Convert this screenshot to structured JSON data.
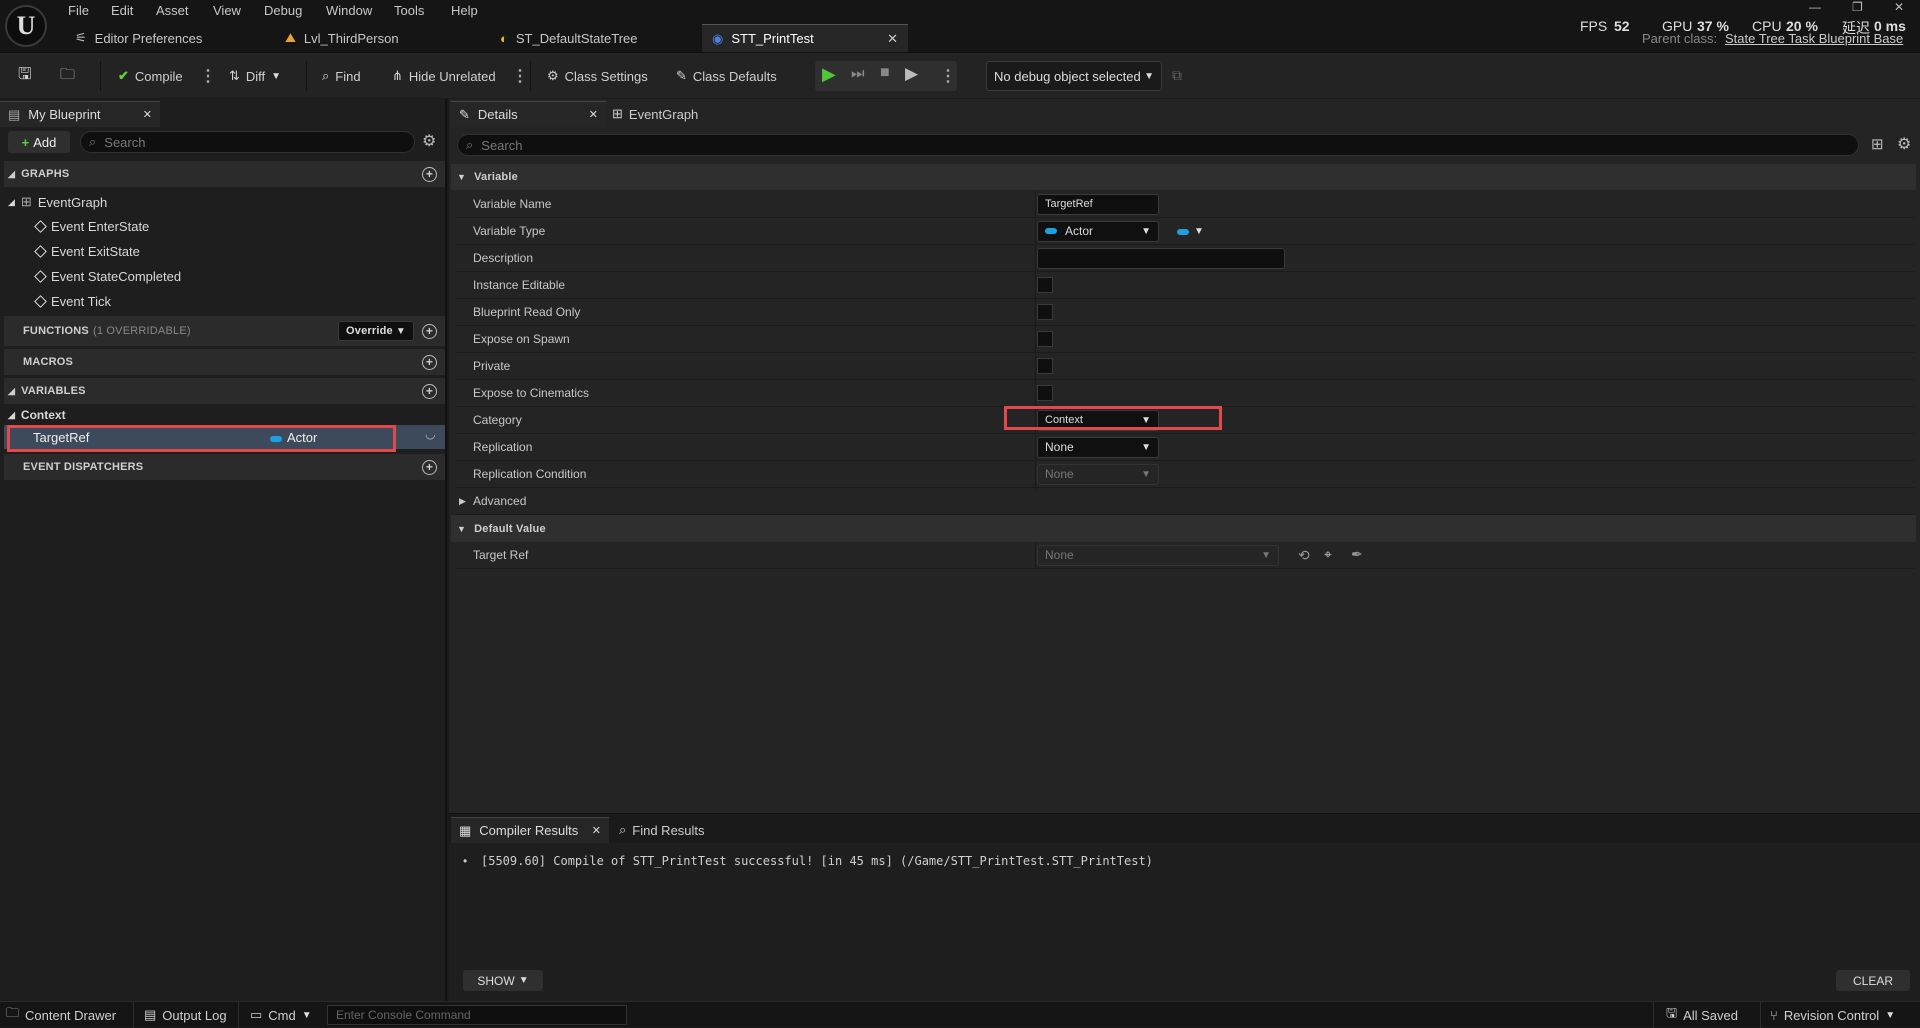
{
  "menu": [
    "File",
    "Edit",
    "Asset",
    "View",
    "Debug",
    "Window",
    "Tools",
    "Help"
  ],
  "tabs": [
    {
      "label": "Editor Preferences",
      "icon": "sliders-icon"
    },
    {
      "label": "Lvl_ThirdPerson",
      "icon": "level-icon"
    },
    {
      "label": "ST_DefaultStateTree",
      "icon": "statetree-icon"
    },
    {
      "label": "STT_PrintTest",
      "icon": "blueprint-icon",
      "active": true
    }
  ],
  "stats": {
    "fps_label": "FPS",
    "fps_value": "52",
    "gpu_label": "GPU",
    "gpu_value": "37 %",
    "cpu_label": "CPU",
    "cpu_value": "20 %",
    "latency_label": "延迟",
    "latency_value": "0 ms",
    "parent_class_label": "Parent class:",
    "parent_class_value": "State Tree Task Blueprint Base"
  },
  "toolbar": {
    "compile": "Compile",
    "diff": "Diff",
    "find": "Find",
    "hide_unrelated": "Hide Unrelated",
    "class_settings": "Class Settings",
    "class_defaults": "Class Defaults",
    "debug_object": "No debug object selected"
  },
  "my_blueprint": {
    "tab_label": "My Blueprint",
    "add_label": "Add",
    "search_placeholder": "Search",
    "graphs_header": "GRAPHS",
    "event_graph": "EventGraph",
    "events": [
      "Event EnterState",
      "Event ExitState",
      "Event StateCompleted",
      "Event Tick"
    ],
    "functions_header": "FUNCTIONS",
    "functions_note": "(1 OVERRIDABLE)",
    "override_label": "Override",
    "macros_header": "MACROS",
    "variables_header": "VARIABLES",
    "category": "Context",
    "variable_name": "TargetRef",
    "variable_type": "Actor",
    "dispatchers_header": "EVENT DISPATCHERS"
  },
  "details": {
    "tab_label": "Details",
    "eventgraph_tab": "EventGraph",
    "search_placeholder": "Search",
    "variable_section": "Variable",
    "rows": {
      "variable_name": "Variable Name",
      "variable_type": "Variable Type",
      "description": "Description",
      "instance_editable": "Instance Editable",
      "blueprint_read_only": "Blueprint Read Only",
      "expose_on_spawn": "Expose on Spawn",
      "private": "Private",
      "expose_to_cinematics": "Expose to Cinematics",
      "category": "Category",
      "replication": "Replication",
      "replication_condition": "Replication Condition",
      "advanced": "Advanced"
    },
    "values": {
      "variable_name": "TargetRef",
      "variable_type": "Actor",
      "description": "",
      "category": "Context",
      "replication": "None",
      "replication_condition": "None"
    },
    "default_value_section": "Default Value",
    "target_ref_label": "Target Ref",
    "target_ref_value": "None"
  },
  "bottom": {
    "compiler_tab": "Compiler Results",
    "find_tab": "Find Results",
    "log_line": "[5509.60] Compile of STT_PrintTest successful! [in 45 ms] (/Game/STT_PrintTest.STT_PrintTest)",
    "show_label": "SHOW",
    "clear_label": "CLEAR"
  },
  "statusbar": {
    "content_drawer": "Content Drawer",
    "output_log": "Output Log",
    "cmd": "Cmd",
    "console_placeholder": "Enter Console Command",
    "all_saved": "All Saved",
    "revision_control": "Revision Control"
  },
  "colors": {
    "actor_pin": "#1ba1e2",
    "highlight": "#e04a4a",
    "selected_row": "#3d4a5c"
  }
}
